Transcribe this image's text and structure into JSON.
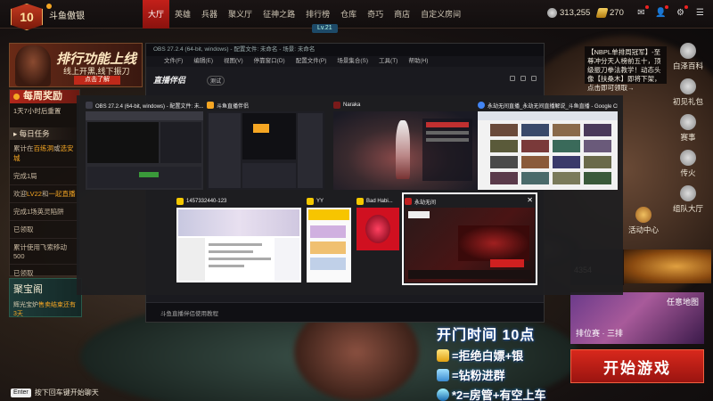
{
  "topbar": {
    "level": "10",
    "club_name": "斗鱼傲银",
    "nav": [
      {
        "label": "大厅",
        "active": true
      },
      {
        "label": "英雄",
        "active": false
      },
      {
        "label": "兵器",
        "active": false
      },
      {
        "label": "聚义厅",
        "active": false
      },
      {
        "label": "征神之路",
        "active": false
      },
      {
        "label": "排行榜",
        "active": false
      },
      {
        "label": "仓库",
        "active": false
      },
      {
        "label": "奇巧",
        "active": false
      },
      {
        "label": "商店",
        "active": false
      },
      {
        "label": "自定义房间",
        "active": false
      }
    ],
    "sub_tag": "Lv.21",
    "currency_1": "313,255",
    "currency_2": "270"
  },
  "rank_banner": {
    "title": "排行功能上线",
    "subtitle": "线上开黑,线下振刀",
    "button": "点击了解"
  },
  "daily": {
    "title": "每周奖励",
    "reset": "1天7小时后重置",
    "tab": "每日任务",
    "lines": [
      {
        "pre": "累计在",
        "hl": "百练洞",
        "post": "或",
        "hl2": "选安城"
      },
      {
        "pre": "完成1局",
        "hl": "",
        "post": "",
        "hl2": ""
      },
      {
        "pre": "欢迎",
        "hl": "LV22",
        "post": "和",
        "hl2": "一起直播"
      },
      {
        "pre": "完成1场英灵陷阱",
        "hl": "",
        "post": "",
        "hl2": ""
      },
      {
        "pre": "已领取",
        "hl": "",
        "post": "",
        "hl2": ""
      },
      {
        "pre": "累计使用飞索移动500",
        "hl": "",
        "post": "",
        "hl2": ""
      },
      {
        "pre": "已领取",
        "hl": "",
        "post": "",
        "hl2": ""
      }
    ]
  },
  "treasure": {
    "title": "聚宝阁",
    "pre": "辉光宝炉",
    "hl": "售卖结束还有3天"
  },
  "enter_hint": {
    "key": "Enter",
    "text": "按下回车键开始聊天"
  },
  "notice": "【NBPL单排周冠军】-至尊冲分天人榜前五十，顶级振刀拳法教学！动态头像【扶桑木】即将下架，点击即可领取→",
  "side_menu": [
    {
      "label": "白泽百科"
    },
    {
      "label": "初见礼包"
    },
    {
      "label": "赛事"
    },
    {
      "label": "传火"
    },
    {
      "label": "组队大厅"
    }
  ],
  "side_activity": [
    {
      "label": "活动中心"
    }
  ],
  "score": "4354",
  "mode_card": {
    "map": "任意地图",
    "mode": "排位赛 · 三排"
  },
  "start_button": "开始游戏",
  "overlay": {
    "headline": "开门时间 10点",
    "line1": "=拒绝白嫖+银",
    "line2": "=钻粉进群",
    "line3": "*2=房管+有空上车"
  },
  "livehime": {
    "titlebar": "OBS 27.2.4 (64-bit, windows) - 配置文件: 未命名 - 场景: 未命名",
    "menus": [
      "文件(F)",
      "编辑(E)",
      "视图(V)",
      "停靠窗口(D)",
      "配置文件(P)",
      "场景集合(S)",
      "工具(T)",
      "帮助(H)"
    ],
    "brand": "直播伴侣",
    "brand_tag": "测试",
    "bottom": "斗鱼直播伴侣使用教程"
  },
  "switcher": {
    "row1": [
      {
        "title": "OBS 27.2.4 (64-bit, windows) - 配置文件: 未...",
        "color": "#3d3d47"
      },
      {
        "title": "斗鱼直播伴侣",
        "color": "#f5a623"
      },
      {
        "title": "Naraka",
        "color": "#7a1a1a"
      },
      {
        "title": "永劫无间直播_永劫无间直播解说_斗鱼直播 - Google Ch...",
        "color": "#4285f4"
      }
    ],
    "row2": [
      {
        "title": "1457332440-123",
        "color": "#f5c800"
      },
      {
        "title": "YY",
        "color": "#f5c800"
      },
      {
        "title": "Bad Habi...",
        "color": "#f5c800"
      },
      {
        "title": "永劫无间",
        "color": "#c02020",
        "selected": true
      }
    ]
  }
}
